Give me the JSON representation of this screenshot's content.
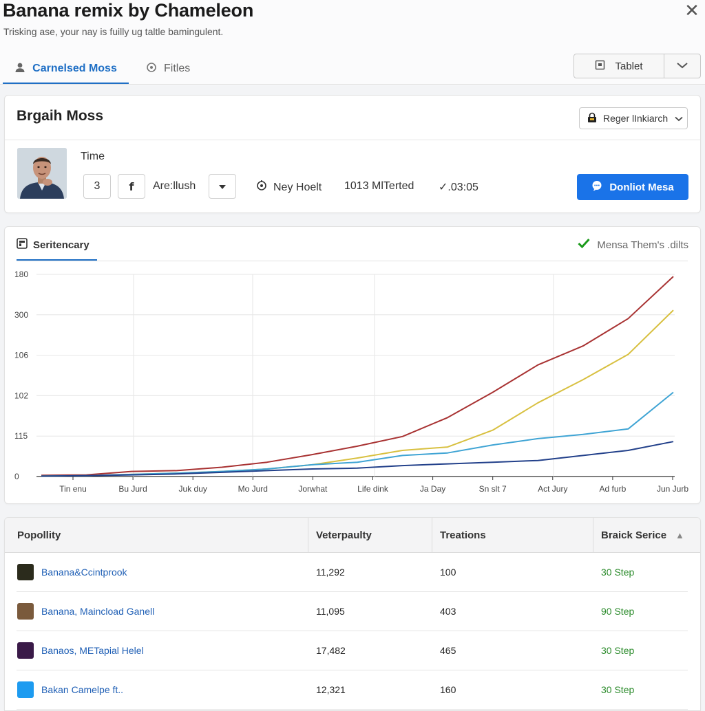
{
  "app": {
    "title": "Banana remix by Chameleon",
    "subtitle": "Trisking ase, your nay is fuilly ug taltle bamingulent."
  },
  "tabs": [
    {
      "label": "Carnelsed Moss",
      "active": true
    },
    {
      "label": "Fitles",
      "active": false
    }
  ],
  "view_button": {
    "label": "Tablet"
  },
  "profile": {
    "name": "Brgaih Moss",
    "region_dropdown": "Reger lInkiarch",
    "time_label": "Time",
    "number_box": "3",
    "facebook_glyph": "f",
    "select_label": "Are:llush",
    "location": "Ney Hoelt",
    "metric": "1013 MlTerted",
    "duration": "✓.03:05",
    "primary_button": "Donliot Mesa"
  },
  "chart_panel": {
    "tab_label": "Seritencary",
    "status_label": "Mensa Them's .dilts",
    "accent": "#1f6fc5",
    "status_color": "#1a9a1a"
  },
  "chart_data": {
    "type": "line",
    "x": [
      "Tin enu",
      "Bu Jurd",
      "Juk duy",
      "Mo Jurd",
      "Jorwhat",
      "Life dink",
      "Ja Day",
      "Sn slt 7",
      "Act Jury",
      "Ad furb",
      "Jun Jurb"
    ],
    "y_tick_labels": [
      "0",
      "115",
      "102",
      "106",
      "300",
      "180"
    ],
    "grid": true,
    "series": [
      {
        "color": "#a83232",
        "values": [
          3,
          4,
          12,
          14,
          22,
          34,
          52,
          72,
          95,
          140,
          200,
          265,
          310,
          375,
          475
        ]
      },
      {
        "color": "#d8c040",
        "values": [
          1,
          2,
          5,
          8,
          12,
          18,
          28,
          44,
          62,
          70,
          110,
          175,
          230,
          290,
          395
        ]
      },
      {
        "color": "#3fa4d4",
        "values": [
          1,
          2,
          5,
          8,
          12,
          18,
          28,
          34,
          50,
          56,
          75,
          90,
          100,
          113,
          200
        ]
      },
      {
        "color": "#22408a",
        "values": [
          1,
          2,
          4,
          6,
          10,
          14,
          18,
          20,
          26,
          30,
          34,
          38,
          50,
          62,
          83
        ]
      }
    ]
  },
  "table": {
    "columns": [
      "Popollity",
      "Veterpaulty",
      "Treations",
      "Braick Serice"
    ],
    "rows": [
      {
        "name": "Banana&Ccintprook",
        "v1": "11,292",
        "v2": "100",
        "v3": "30 Step",
        "thumb": "#2b2b1c"
      },
      {
        "name": "Banana, Maincload Ganell",
        "v1": "11,095",
        "v2": "403",
        "v3": "90 Step",
        "thumb": "#7a5a3c"
      },
      {
        "name": "Banaos, METapial Helel",
        "v1": "17,482",
        "v2": "465",
        "v3": "30 Step",
        "thumb": "#3a1a48"
      },
      {
        "name": "Bakan Camelpe ft..",
        "v1": "12,321",
        "v2": "160",
        "v3": "30 Step",
        "thumb": "#1d9bf0"
      }
    ]
  }
}
